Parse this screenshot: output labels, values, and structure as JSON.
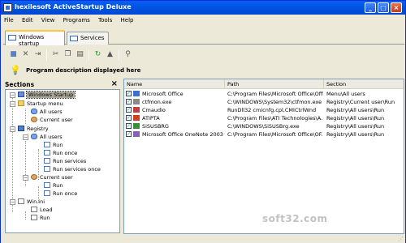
{
  "window": {
    "title": "hexilesoft ActiveStartup Deluxe"
  },
  "menu": [
    "File",
    "Edit",
    "View",
    "Programs",
    "Tools",
    "Help"
  ],
  "tabs": [
    {
      "label": "Windows startup"
    },
    {
      "label": "Services"
    }
  ],
  "description": "Program description displayed here",
  "sections": {
    "title": "Sections",
    "tree": [
      {
        "label": "Windows Startup"
      },
      {
        "label": "Startup menu"
      },
      {
        "label": "All users"
      },
      {
        "label": "Current user"
      },
      {
        "label": "Registry"
      },
      {
        "label": "All users"
      },
      {
        "label": "Run"
      },
      {
        "label": "Run once"
      },
      {
        "label": "Run services"
      },
      {
        "label": "Run services once"
      },
      {
        "label": "Current user"
      },
      {
        "label": "Run"
      },
      {
        "label": "Run once"
      },
      {
        "label": "Win.ini"
      },
      {
        "label": "Load"
      },
      {
        "label": "Run"
      }
    ]
  },
  "list": {
    "columns": [
      "Name",
      "Path",
      "Section"
    ],
    "rows": [
      {
        "name": "Microsoft Office",
        "path": "C:\\Program Files\\Microsoft Office\\Offi...",
        "section": "Menu\\All users",
        "checked": true
      },
      {
        "name": "ctfmon.exe",
        "path": "C:\\WINDOWS\\System32\\ctfmon.exe",
        "section": "Registry\\Current user\\Run",
        "checked": true
      },
      {
        "name": "Cmaudio",
        "path": "RunDll32 cmicnfg.cpl,CMICtrlWnd",
        "section": "Registry\\All users\\Run",
        "checked": true
      },
      {
        "name": "ATIPTA",
        "path": "C:\\Program Files\\ATI Technologies\\A...",
        "section": "Registry\\All users\\Run",
        "checked": true
      },
      {
        "name": "SiSUSBRG",
        "path": "C:\\WINDOWS\\SiSUSBrg.exe",
        "section": "Registry\\All users\\Run",
        "checked": true
      },
      {
        "name": "Microsoft Office OneNote 2003...",
        "path": "C:\\Program Files\\Microsoft Office\\OF...",
        "section": "Registry\\All users\\Run",
        "checked": true
      }
    ]
  },
  "watermark": "soft32.com",
  "icons": {
    "tab1": "window-icon",
    "tab2": "services-icon",
    "description": "lightbulb-icon"
  }
}
